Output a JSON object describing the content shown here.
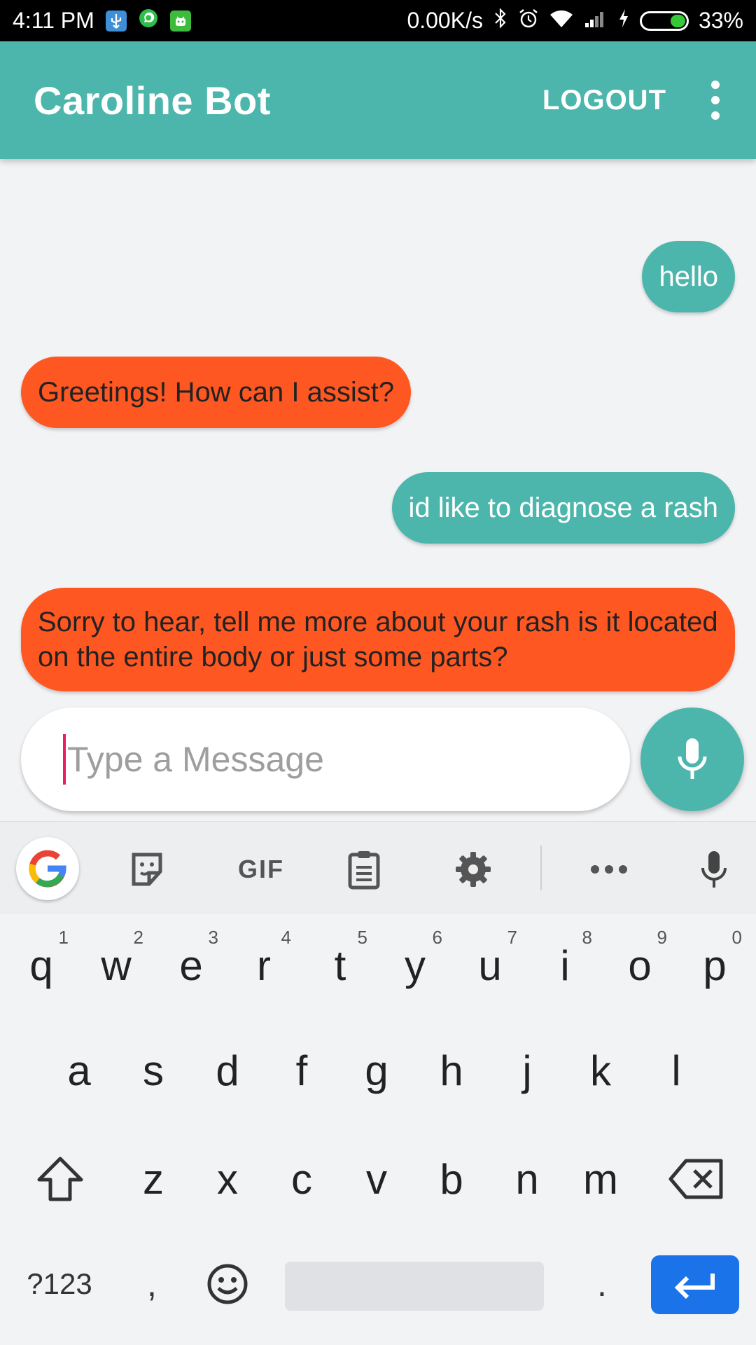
{
  "status_bar": {
    "time": "4:11 PM",
    "net_speed": "0.00K/s",
    "battery": "33%",
    "battery_level": 0.33,
    "icons": [
      "usb-icon",
      "whatsapp-icon",
      "android-icon",
      "bluetooth-icon",
      "alarm-icon",
      "wifi-icon",
      "signal-icon",
      "charging-icon",
      "battery-icon"
    ]
  },
  "app_bar": {
    "title": "Caroline Bot",
    "logout_label": "LOGOUT",
    "menu_icon": "more-vert-icon",
    "color": "#4db6ac"
  },
  "messages": [
    {
      "sender": "user",
      "text": "hello"
    },
    {
      "sender": "bot",
      "text": "Greetings! How can I assist?"
    },
    {
      "sender": "user",
      "text": "id like to diagnose a rash"
    },
    {
      "sender": "bot",
      "text": "Sorry to hear, tell me more about your rash is it located on the entire body or just some parts?"
    }
  ],
  "composer": {
    "placeholder": "Type a Message",
    "mic_icon": "mic-icon"
  },
  "keyboard": {
    "toolbar": [
      "google-icon",
      "sticker-icon",
      "GIF",
      "clipboard-icon",
      "gear-icon",
      "more-horiz-icon",
      "mic-icon"
    ],
    "gif_label": "GIF",
    "row1": [
      {
        "key": "q",
        "hint": "1"
      },
      {
        "key": "w",
        "hint": "2"
      },
      {
        "key": "e",
        "hint": "3"
      },
      {
        "key": "r",
        "hint": "4"
      },
      {
        "key": "t",
        "hint": "5"
      },
      {
        "key": "y",
        "hint": "6"
      },
      {
        "key": "u",
        "hint": "7"
      },
      {
        "key": "i",
        "hint": "8"
      },
      {
        "key": "o",
        "hint": "9"
      },
      {
        "key": "p",
        "hint": "0"
      }
    ],
    "row2": [
      "a",
      "s",
      "d",
      "f",
      "g",
      "h",
      "j",
      "k",
      "l"
    ],
    "row3": [
      "z",
      "x",
      "c",
      "v",
      "b",
      "n",
      "m"
    ],
    "symbols_label": "?123",
    "comma": ",",
    "period": ".",
    "accent": "#1a73e8"
  },
  "colors": {
    "user_bubble": "#4db6ac",
    "bot_bubble": "#ff5722",
    "caret": "#e91e63"
  }
}
